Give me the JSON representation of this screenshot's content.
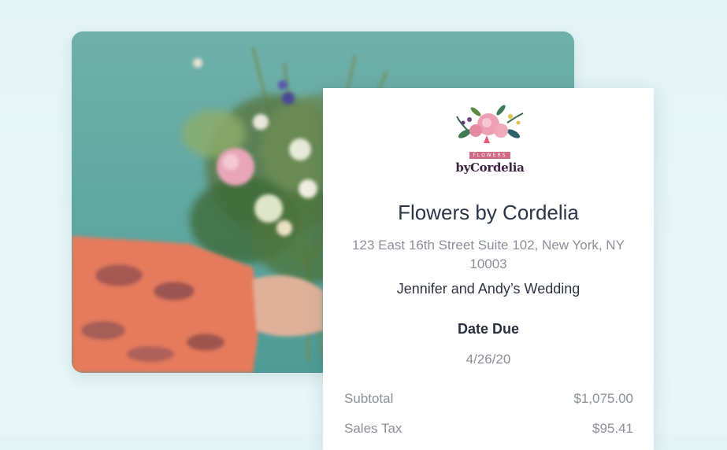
{
  "photo": {
    "description_icon": "bouquet-photo"
  },
  "receipt": {
    "logo": {
      "band_text": "FLOWERS",
      "brand_text": "byCordelia"
    },
    "business_name": "Flowers by Cordelia",
    "address": "123 East 16th Street Suite 102, New York, NY 10003",
    "event_name": "Jennifer and Andy’s Wedding",
    "date_due_label": "Date Due",
    "date_due_value": "4/26/20",
    "line_items": [
      {
        "label": "Subtotal",
        "value": "$1,075.00"
      },
      {
        "label": "Sales Tax",
        "value": "$95.41"
      }
    ]
  },
  "colors": {
    "page_background": "#e3f4f6",
    "photo_background": "#5fa6a0",
    "brand_pink": "#d06a85",
    "brand_dark": "#3b2342"
  }
}
